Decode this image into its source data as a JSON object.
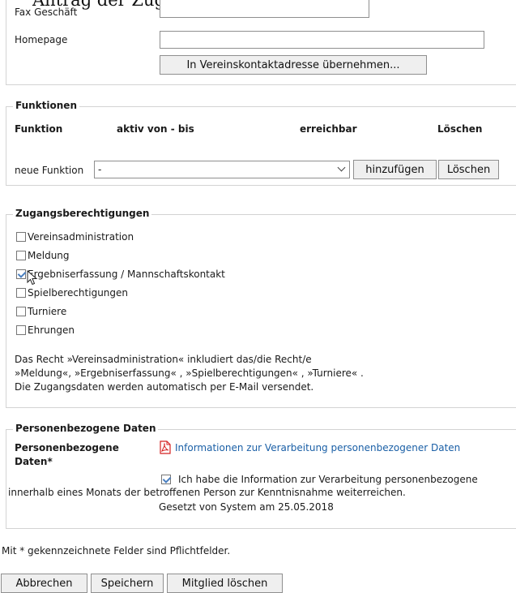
{
  "top_cut_heading": "Antrag der Zugangsberechtigungen",
  "contact": {
    "fax_label": "Fax Geschäft",
    "homepage_label": "Homepage",
    "homepage_value": "",
    "transfer_button": "In Vereinskontaktadresse übernehmen..."
  },
  "functions": {
    "legend": "Funktionen",
    "col_function": "Funktion",
    "col_active": "aktiv von - bis",
    "col_reachable": "erreichbar",
    "col_delete": "Löschen",
    "new_label": "neue Funktion",
    "select_value": "-",
    "add_button": "hinzufügen",
    "delete_button": "Löschen"
  },
  "access": {
    "legend": "Zugangsberechtigungen",
    "items": [
      {
        "label": "Vereinsadministration",
        "checked": false
      },
      {
        "label": "Meldung",
        "checked": false
      },
      {
        "label": "Ergebniserfassung / Mannschaftskontakt",
        "checked": true
      },
      {
        "label": "Spielberechtigungen",
        "checked": false
      },
      {
        "label": "Turniere",
        "checked": false
      },
      {
        "label": "Ehrungen",
        "checked": false
      }
    ],
    "note_line1": "Das Recht »Vereinsadministration« inkludiert das/die Recht/e",
    "note_line2": "»Meldung«, »Ergebniserfassung« , »Spielberechtigungen« , »Turniere« .",
    "note_line3": "Die Zugangsdaten werden automatisch per E-Mail versendet."
  },
  "privacy": {
    "legend": "Personenbezogene Daten",
    "field_label_1": "Personenbezogene",
    "field_label_2": "Daten*",
    "info_link": "Informationen zur Verarbeitung personenbezogener Daten",
    "consent_text": "Ich habe die Information zur Verarbeitung personenbezogene",
    "consent_line2": "innerhalb eines Monats der betroffenen Person zur Kenntnisnahme weiterreichen.",
    "set_by": "Gesetzt von System am 25.05.2018"
  },
  "required_note": "Mit * gekennzeichnete Felder sind Pflichtfelder.",
  "actions": {
    "cancel": "Abbrechen",
    "save": "Speichern",
    "delete_member": "Mitglied löschen"
  },
  "colors": {
    "link": "#1a5fa6",
    "pdf_icon": "#d42020",
    "checkmark": "#4a7fc0"
  }
}
